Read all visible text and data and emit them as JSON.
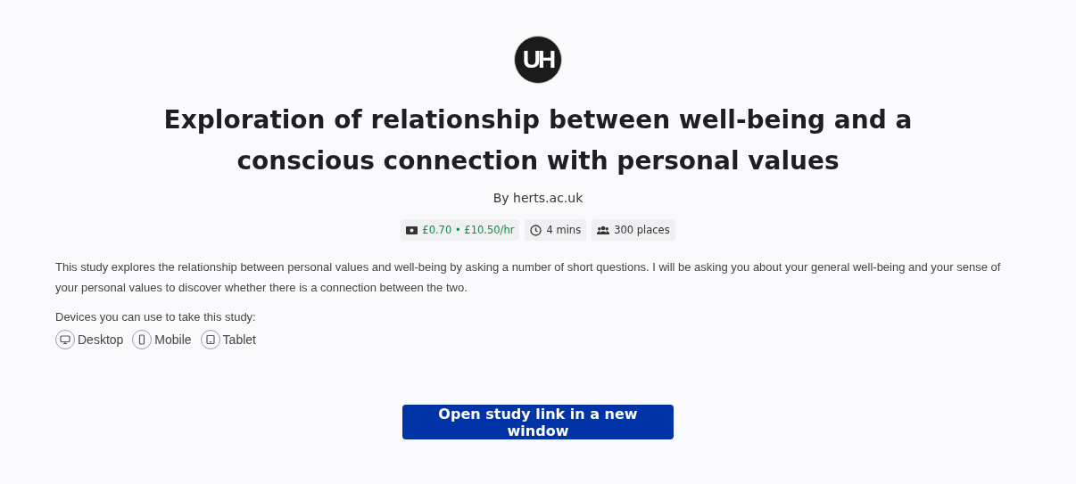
{
  "logo": {
    "text": "UH"
  },
  "title": "Exploration of relationship between well-being and a conscious connection with personal values",
  "byline": "By herts.ac.uk",
  "tags": [
    {
      "kind": "reward",
      "label": "£0.70 • £10.50/hr"
    },
    {
      "kind": "time",
      "label": "4 mins"
    },
    {
      "kind": "places",
      "label": "300 places"
    }
  ],
  "description": "This study explores the relationship between personal values and well-being by asking a number of short questions. I will be asking you about your general well-being and your sense of your personal values to discover whether there is a connection between the two.",
  "devices_label": "Devices you can use to take this study:",
  "devices": [
    {
      "kind": "desktop",
      "label": "Desktop"
    },
    {
      "kind": "mobile",
      "label": "Mobile"
    },
    {
      "kind": "tablet",
      "label": "Tablet"
    }
  ],
  "button": "Open study link in a new window"
}
